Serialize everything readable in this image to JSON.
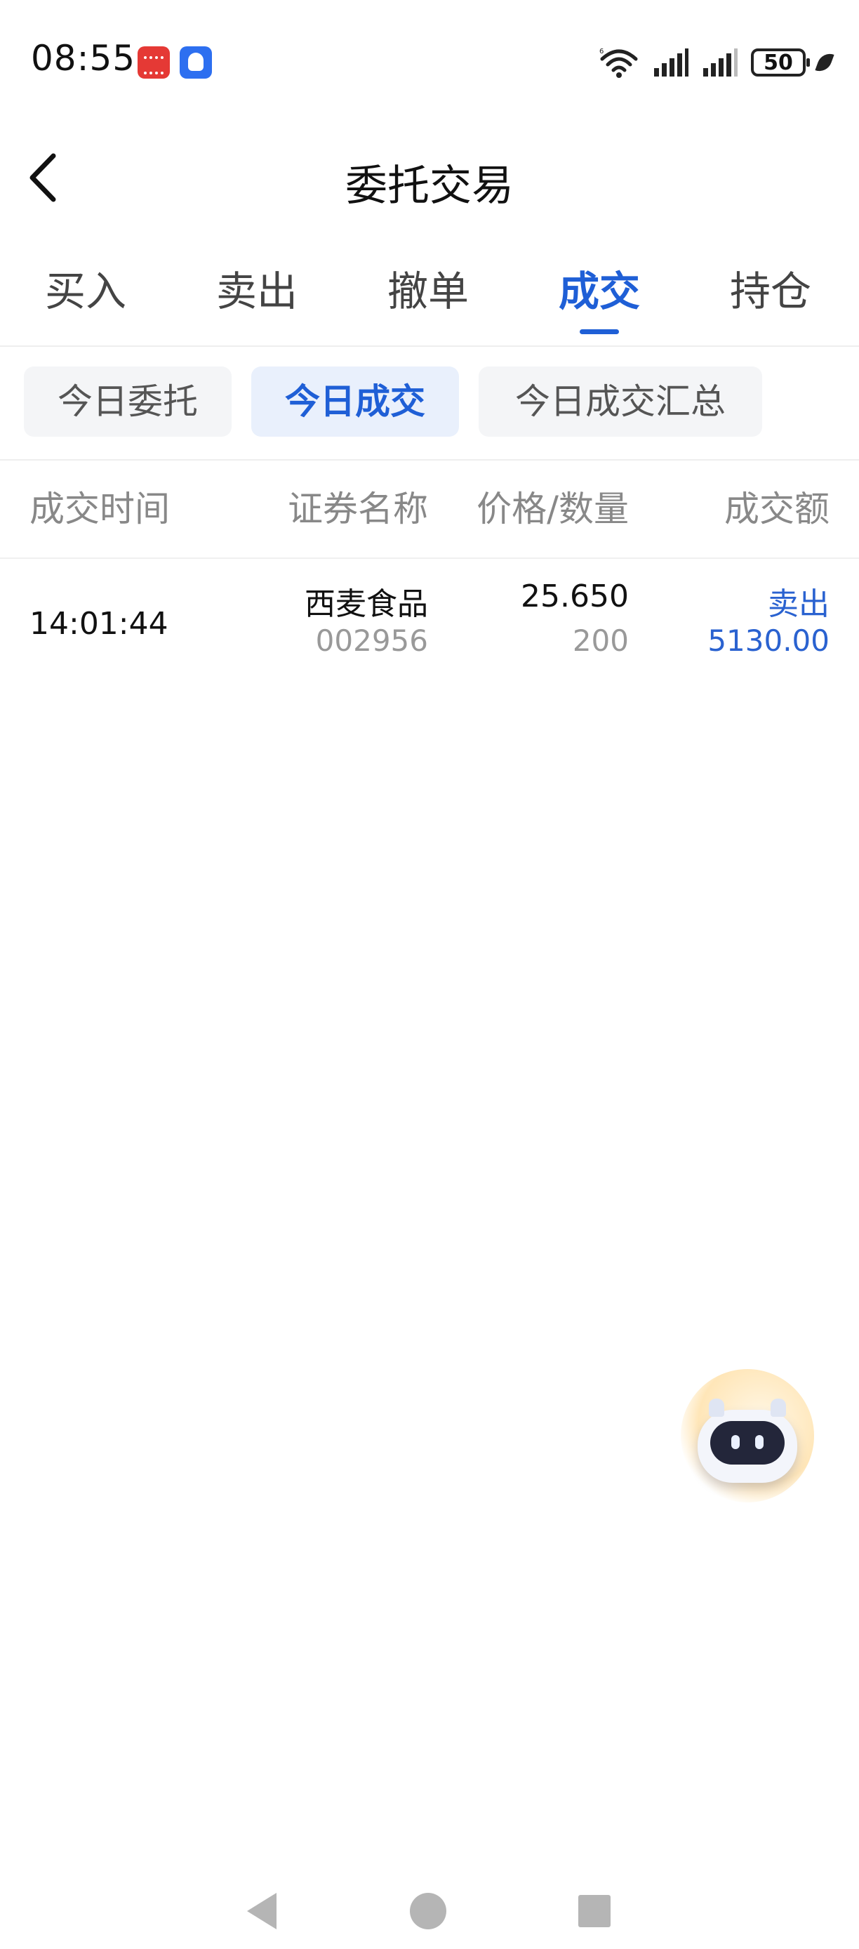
{
  "status_bar": {
    "time": "08:55",
    "battery": "50"
  },
  "header": {
    "title": "委托交易"
  },
  "main_tabs": [
    {
      "label": "买入"
    },
    {
      "label": "卖出"
    },
    {
      "label": "撤单"
    },
    {
      "label": "成交",
      "active": true
    },
    {
      "label": "持仓"
    }
  ],
  "sub_tabs": [
    {
      "label": "今日委托"
    },
    {
      "label": "今日成交",
      "active": true
    },
    {
      "label": "今日成交汇总"
    }
  ],
  "table": {
    "headers": [
      "成交时间",
      "证券名称",
      "价格/数量",
      "成交额"
    ],
    "rows": [
      {
        "time": "14:01:44",
        "name": "西麦食品",
        "code": "002956",
        "price": "25.650",
        "quantity": "200",
        "direction": "卖出",
        "amount": "5130.00"
      }
    ]
  },
  "colors": {
    "accent": "#1f5fd6",
    "sell": "#2a62d0",
    "muted": "#999999"
  },
  "icons": {
    "back": "chevron-left-icon",
    "assistant": "robot-assistant-icon",
    "nav_back": "triangle-back-icon",
    "nav_home": "circle-home-icon",
    "nav_recent": "square-recents-icon"
  }
}
